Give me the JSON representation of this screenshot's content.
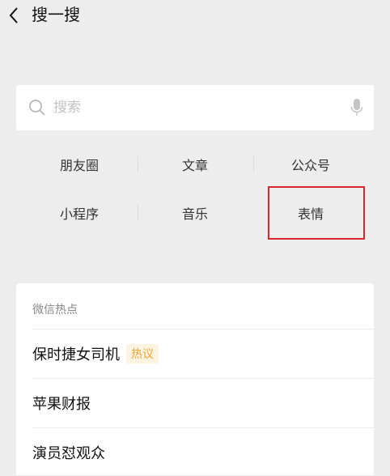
{
  "header": {
    "title": "搜一搜",
    "back_icon": "chevron-left-icon"
  },
  "search": {
    "placeholder": "搜索",
    "value": "",
    "search_icon": "search-icon",
    "voice_icon": "microphone-icon"
  },
  "categories": [
    {
      "label": "朋友圈"
    },
    {
      "label": "文章"
    },
    {
      "label": "公众号"
    },
    {
      "label": "小程序"
    },
    {
      "label": "音乐"
    },
    {
      "label": "表情",
      "highlighted": true
    }
  ],
  "highlight_color": "#d9272e",
  "hot": {
    "heading": "微信热点",
    "items": [
      {
        "text": "保时捷女司机",
        "badge": "热议"
      },
      {
        "text": "苹果财报",
        "badge": ""
      },
      {
        "text": "演员怼观众",
        "badge": ""
      }
    ],
    "badge_color": "#f0a43a"
  }
}
